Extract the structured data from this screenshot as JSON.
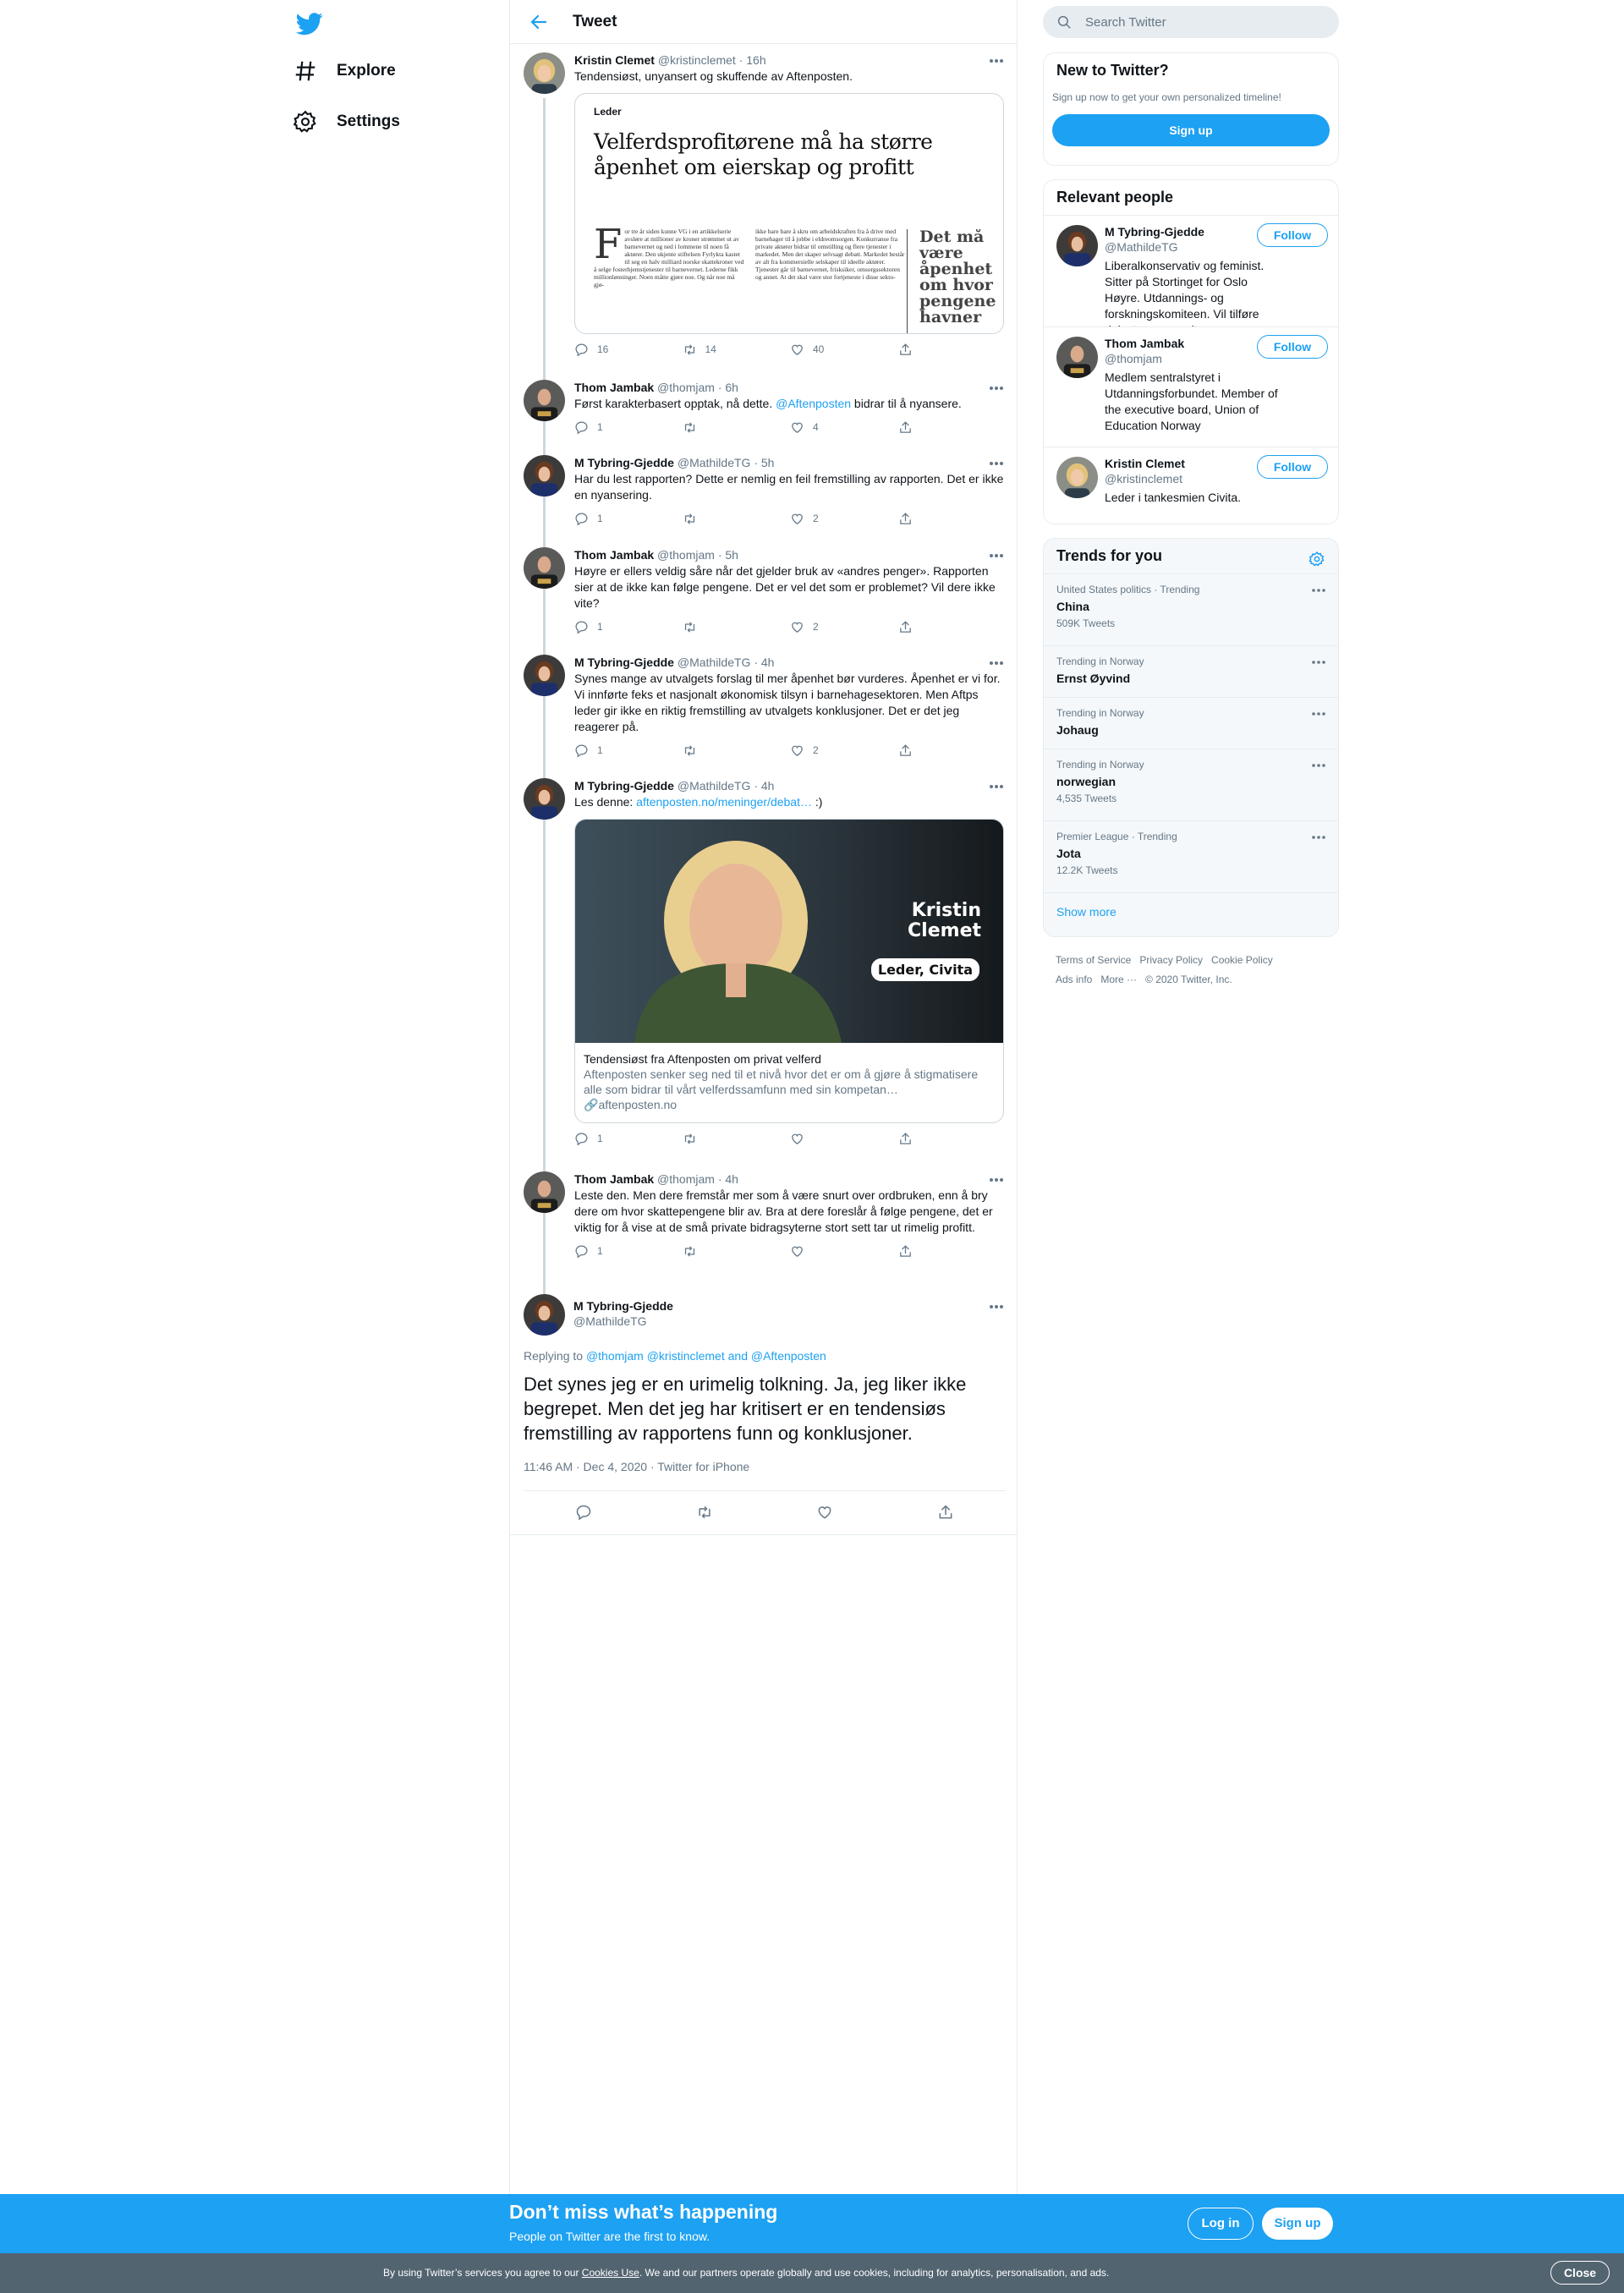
{
  "nav": {
    "explore": "Explore",
    "settings": "Settings"
  },
  "header": {
    "title": "Tweet"
  },
  "thread": [
    {
      "name": "Kristin Clemet",
      "handle": "@kristinclemet",
      "time": "· 16h",
      "text": "Tendensiøst, unyansert og skuffende av Aftenposten.",
      "replies": "16",
      "retweets": "14",
      "likes": "40"
    },
    {
      "name": "Thom Jambak",
      "handle": "@thomjam",
      "time": "· 6h",
      "text_pre": "Først karakterbasert opptak, nå dette. ",
      "mention": "@Aftenposten",
      "text_post": " bidrar til å nyansere.",
      "replies": "1",
      "retweets": "",
      "likes": "4"
    },
    {
      "name": "M Tybring-Gjedde",
      "handle": "@MathildeTG",
      "time": "· 5h",
      "text": "Har du lest rapporten? Dette er nemlig en feil fremstilling av rapporten. Det er ikke en nyansering.",
      "replies": "1",
      "retweets": "",
      "likes": "2"
    },
    {
      "name": "Thom Jambak",
      "handle": "@thomjam",
      "time": "· 5h",
      "text": "Høyre er ellers veldig såre når det gjelder bruk av «andres penger». Rapporten sier at de ikke kan følge pengene. Det er vel det som er problemet? Vil dere ikke vite?",
      "replies": "1",
      "retweets": "",
      "likes": "2"
    },
    {
      "name": "M Tybring-Gjedde",
      "handle": "@MathildeTG",
      "time": "· 4h",
      "text": "Synes mange av utvalgets forslag til mer åpenhet bør vurderes. Åpenhet er vi for. Vi innførte feks et nasjonalt økonomisk tilsyn i barnehagesektoren. Men Aftps leder gir ikke en riktig fremstilling av utvalgets konklusjoner. Det er det jeg reagerer på.",
      "replies": "1",
      "retweets": "",
      "likes": "2"
    },
    {
      "name": "M Tybring-Gjedde",
      "handle": "@MathildeTG",
      "time": "· 4h",
      "text_pre": "Les denne: ",
      "link": "aftenposten.no/meninger/debat…",
      "text_post": " :)",
      "replies": "1",
      "retweets": "",
      "likes": ""
    },
    {
      "name": "Thom Jambak",
      "handle": "@thomjam",
      "time": "· 4h",
      "text": "Leste den. Men dere fremstår mer som å være snurt over ordbruken, enn å bry dere om hvor skattepengene blir av. Bra at dere foreslår å følge pengene, det er viktig for å vise at de små private bidragsyterne stort sett tar ut rimelig profitt.",
      "replies": "1",
      "retweets": "",
      "likes": ""
    }
  ],
  "newscard": {
    "label": "Leder",
    "headline": "Velferdsprofitørene må ha større åpenhet om eierskap og profitt",
    "drop": "F",
    "col1": "or tre år siden kunne VG i en artikkelserie avsløre at millioner av kroner strømmet ut av barnevernet og ned i lommene til noen få aktører. Den ukjente stiftelsen Fyrlykta kastet til seg en halv milliard norske skattekroner ved å selge fosterhjemstjenester til barnevernet. Lederne fikk millionlønninger. Noen måtte gjøre noe. Og når noe må gjø-",
    "col2": "ikke bare bare å skru om arbeidskraften fra å drive med barnehager til å jobbe i eldreomsorgen. Konkurranse fra private aktører bidrar til omstilling og flere tjenester i markedet. Men det skaper selvsagt debatt. Markedet består av alt fra kommersielle selskaper til ideelle aktører. Tjenester går til barnevernet, frisksiker, omsorgssektoren og annet. At det skal være stor fortjeneste i disse sekto-",
    "side": "Det må være åpenhet om hvor pengene havner"
  },
  "linkcard": {
    "overlay_name": "Kristin Clemet",
    "overlay_badge": "Leder, Civita",
    "title": "Tendensiøst fra Aftenposten om privat velferd",
    "desc": "Aftenposten senker seg ned til et nivå hvor det er om å gjøre å stigmatisere alle som bidrar til vårt velferdssamfunn med sin kompetan…",
    "domain": "aftenposten.no"
  },
  "focus": {
    "name": "M Tybring-Gjedde",
    "handle": "@MathildeTG",
    "replying_prefix": "Replying to ",
    "replying_to": "@thomjam @kristinclemet and @Aftenposten",
    "text": "Det synes jeg er en urimelig tolkning. Ja, jeg liker ikke begrepet. Men det jeg har kritisert er en tendensiøs fremstilling av rapportens funn og konklusjoner.",
    "timestamp": "11:46 AM · Dec 4, 2020 · Twitter for iPhone"
  },
  "search": {
    "placeholder": "Search Twitter"
  },
  "new_to_twitter": {
    "title": "New to Twitter?",
    "desc": "Sign up now to get your own personalized timeline!",
    "button": "Sign up"
  },
  "relevant": {
    "title": "Relevant people",
    "follow_label": "Follow",
    "people": [
      {
        "name": "M Tybring-Gjedde",
        "handle": "@MathildeTG",
        "bio": "Liberalkonservativ og feminist. Sitter på Stortinget for Oslo Høyre. Utdannings- og forskningskomiteen. Vil tilføre debatter noe godt."
      },
      {
        "name": "Thom Jambak",
        "handle": "@thomjam",
        "bio": "Medlem sentralstyret i Utdanningsforbundet. Member of the executive board, Union of Education Norway"
      },
      {
        "name": "Kristin Clemet",
        "handle": "@kristinclemet",
        "bio": "Leder i tankesmien Civita."
      }
    ]
  },
  "trends": {
    "title": "Trends for you",
    "items": [
      {
        "context": "United States politics · Trending",
        "name": "China",
        "count": "509K Tweets"
      },
      {
        "context": "Trending in Norway",
        "name": "Ernst Øyvind",
        "count": ""
      },
      {
        "context": "Trending in Norway",
        "name": "Johaug",
        "count": ""
      },
      {
        "context": "Trending in Norway",
        "name": "norwegian",
        "count": "4,535 Tweets"
      },
      {
        "context": "Premier League · Trending",
        "name": "Jota",
        "count": "12.2K Tweets"
      }
    ],
    "show_more": "Show more"
  },
  "footer": {
    "terms": "Terms of Service",
    "privacy": "Privacy Policy",
    "cookie": "Cookie Policy",
    "ads": "Ads info",
    "more": "More ···",
    "copyright": "© 2020 Twitter, Inc."
  },
  "banner": {
    "headline": "Don’t miss what’s happening",
    "sub": "People on Twitter are the first to know.",
    "login": "Log in",
    "signup": "Sign up"
  },
  "cookie": {
    "pre": "By using Twitter’s services you agree to our ",
    "link": "Cookies Use",
    "post": ". We and our partners operate globally and use cookies, including for analytics, personalisation, and ads.",
    "close": "Close"
  },
  "colors": {
    "accent": "#1da1f2",
    "text": "#0f1419",
    "muted": "#657786",
    "border": "#e6ecf0"
  }
}
